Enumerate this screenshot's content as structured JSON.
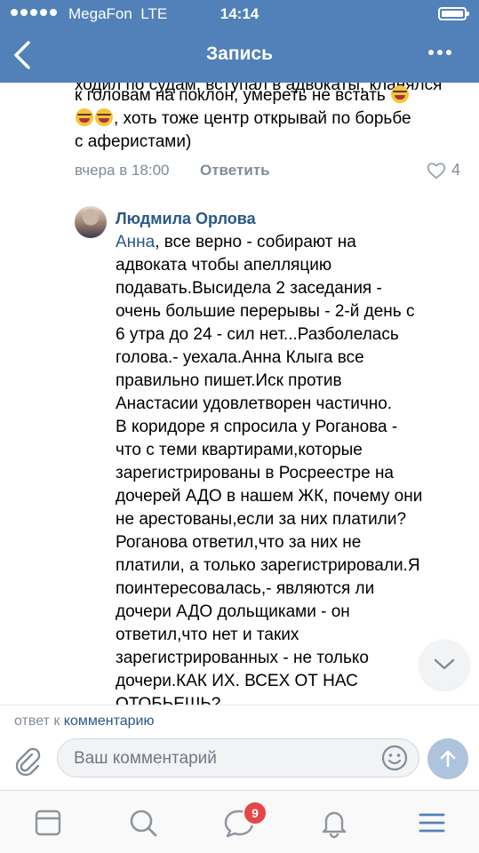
{
  "status_bar": {
    "carrier": "MegaFon",
    "network": "LTE",
    "time": "14:14"
  },
  "nav": {
    "title": "Запись",
    "back_icon": "chevron-left-icon",
    "more_icon": "more-horizontal-icon"
  },
  "previous_comment": {
    "top_fragment": "ходил по судам, вступал в адвокаты, кланялся",
    "text_line1": "к головам на поклон, умереть не встать",
    "text_line2": ", хоть тоже центр открывай по борьбе",
    "text_line3": "с аферистами)",
    "time": "вчера в 18:00",
    "reply_label": "Ответить",
    "likes": "4"
  },
  "reply_comment": {
    "author": "Людмила Орлова",
    "mention": "Анна",
    "lines": [
      ", все верно - собирают на",
      "адвоката чтобы апелляцию",
      "подавать.Высидела 2 заседания -",
      "очень большие перерывы - 2-й день с",
      "6 утра до 24 - сил нет...Разболелась",
      "голова.- уехала.Анна Клыга все",
      "правильно пишет.Иск против",
      "Анастасии удовлетворен частично.",
      "В коридоре я спросила у Роганова -",
      "что с теми квартирами,которые",
      "зарегистрированы в Росреестре на",
      "дочерей АДО в нашем ЖК, почему они",
      "не арестованы,если за них платили?",
      "Роганова ответил,что за них не",
      "платили, а только зарегистрировали.Я",
      "поинтересовалась,- являются ли",
      "дочери АДО дольщиками - он",
      "ответил,что нет и таких",
      "зарегистрированных - не только",
      "дочери.КАК ИХ. ВСЕХ ОТ НАС",
      "ОТОБЬЕШЬ?"
    ]
  },
  "composer": {
    "reply_prefix": "ответ к",
    "reply_link": "комментарию",
    "placeholder": "Ваш комментарий"
  },
  "tabbar": {
    "messages_badge": "9"
  },
  "colors": {
    "header_bg": "#5181b8",
    "link": "#2a5885",
    "muted": "#818c99",
    "badge": "#e64646"
  }
}
